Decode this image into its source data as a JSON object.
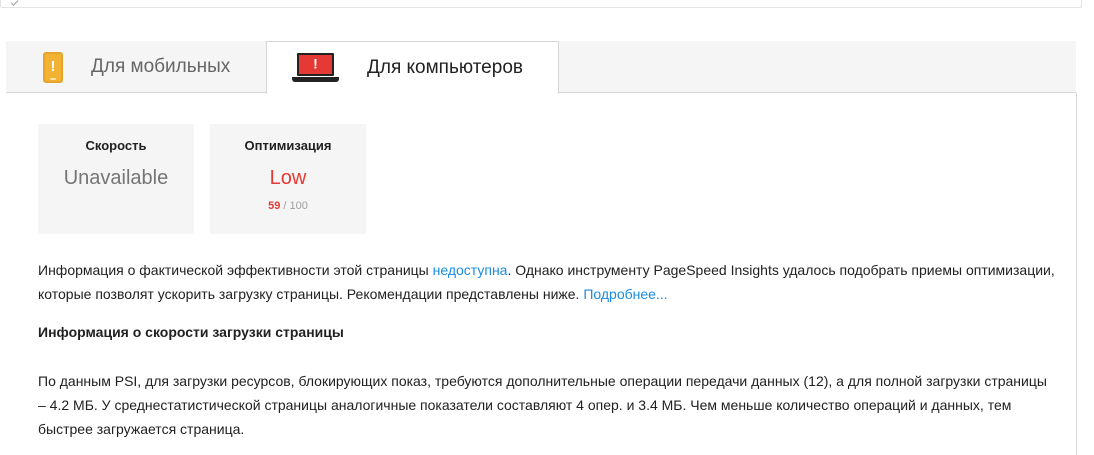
{
  "tabs": [
    {
      "label": "Для мобильных",
      "icon": "phone-warning-icon",
      "color": "#f2b233"
    },
    {
      "label": "Для компьютеров",
      "icon": "laptop-error-icon",
      "color": "#e53935"
    }
  ],
  "cards": {
    "speed": {
      "title": "Скорость",
      "value": "Unavailable"
    },
    "optimization": {
      "title": "Оптимизация",
      "value": "Low",
      "score": "59",
      "max": "/ 100",
      "color": "#e53935"
    }
  },
  "info": {
    "text1": "Информация о фактической эффективности этой страницы ",
    "link1": "недоступна",
    "text2": ". Однако инструменту PageSpeed Insights удалось подобрать приемы оптимизации, которые позволят ускорить загрузку страницы. Рекомендации представлены ниже. ",
    "link2": "Подробнее..."
  },
  "section": {
    "heading": "Информация о скорости загрузки страницы",
    "body": "По данным PSI, для загрузки ресурсов, блокирующих показ, требуются дополнительные операции передачи данных (12), а для полной загрузки страницы – 4.2 МБ. У среднестатистической страницы аналогичные показатели составляют 4 опер. и 3.4 МБ. Чем меньше количество операций и данных, тем быстрее загружается страница."
  },
  "colors": {
    "link": "#1a8cdf",
    "warning": "#f2b233",
    "error": "#e53935"
  }
}
